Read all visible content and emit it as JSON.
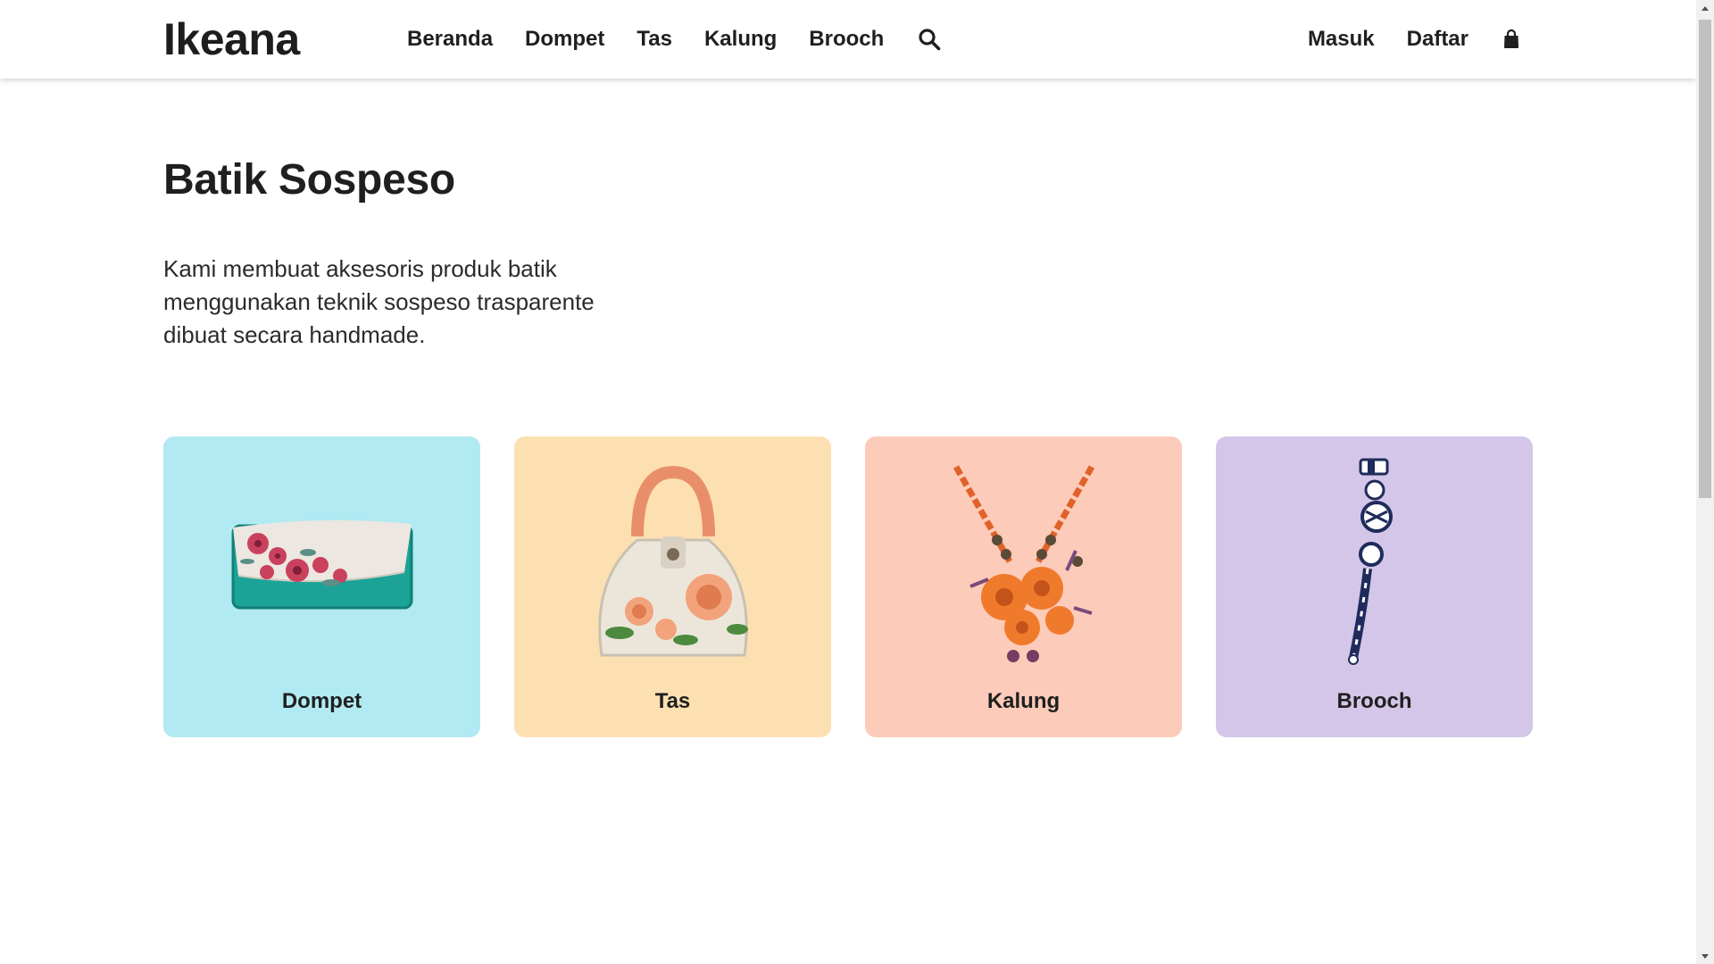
{
  "header": {
    "brand": "Ikeana",
    "nav": [
      "Beranda",
      "Dompet",
      "Tas",
      "Kalung",
      "Brooch"
    ],
    "auth": {
      "login": "Masuk",
      "register": "Daftar"
    },
    "icons": {
      "search": "search-icon",
      "cart": "shopping-bag-icon"
    }
  },
  "hero": {
    "title": "Batik Sospeso",
    "description": "Kami membuat aksesoris produk batik menggunakan teknik sospeso trasparente dibuat secara handmade."
  },
  "categories": [
    {
      "label": "Dompet",
      "bg": "#b1eaf2",
      "icon": "clutch-purse-image"
    },
    {
      "label": "Tas",
      "bg": "#fde0b1",
      "icon": "handbag-image"
    },
    {
      "label": "Kalung",
      "bg": "#fdcbb9",
      "icon": "necklace-image"
    },
    {
      "label": "Brooch",
      "bg": "#d3c6e9",
      "icon": "brooch-image"
    }
  ]
}
